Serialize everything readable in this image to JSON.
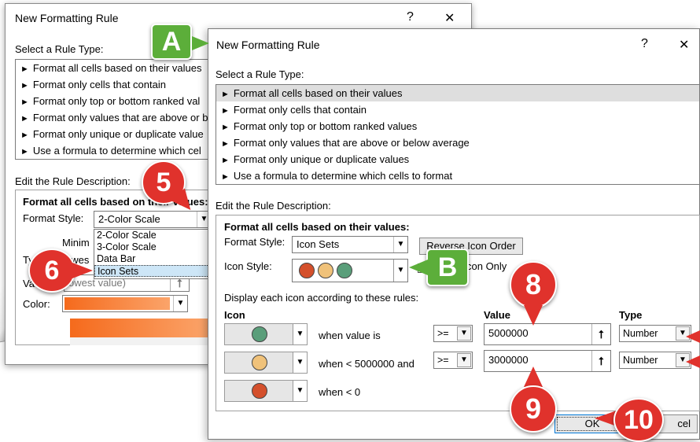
{
  "back_dialog": {
    "title": "New Formatting Rule",
    "help": "?",
    "close": "✕",
    "select_rule_type_label": "Select a Rule Type:",
    "rule_types": [
      "Format all cells based on their values",
      "Format only cells that contain",
      "Format only top or bottom ranked val",
      "Format only values that are above or b",
      "Format only unique or duplicate value",
      "Use a formula to determine which cel"
    ],
    "edit_label": "Edit the Rule Description:",
    "format_all_label": "Format all cells based on their values:",
    "format_style_label": "Format Style:",
    "format_style_value": "2-Color Scale",
    "minimum_label": "Minim",
    "type_label": "Typ",
    "type_partial": "owes",
    "value_label": "Va",
    "value_placeholder": "owest value)",
    "color_label": "Color:",
    "dropdown_options": [
      "2-Color Scale",
      "3-Color Scale",
      "Data Bar",
      "Icon Sets"
    ],
    "selected_option": "Icon Sets"
  },
  "front_dialog": {
    "title": "New Formatting Rule",
    "help": "?",
    "close": "✕",
    "select_rule_type_label": "Select a Rule Type:",
    "rule_types": [
      "Format all cells based on their values",
      "Format only cells that contain",
      "Format only top or bottom ranked values",
      "Format only values that are above or below average",
      "Format only unique or duplicate values",
      "Use a formula to determine which cells to format"
    ],
    "edit_label": "Edit the Rule Description:",
    "format_all_label": "Format all cells based on their values:",
    "format_style_label": "Format Style:",
    "format_style_value": "Icon Sets",
    "reverse_icon_order": "Reverse Icon Order",
    "icon_style_label": "Icon Style:",
    "show_icon_only": "con Only",
    "display_rules_label": "Display each icon according to these rules:",
    "col_icon": "Icon",
    "col_value": "Value",
    "col_type": "Type",
    "rules": [
      {
        "icon_color": "#5a9e7a",
        "condition": "when value is",
        "operator": ">=",
        "value": "5000000",
        "type": "Number"
      },
      {
        "icon_color": "#f0c27a",
        "condition": "when < 5000000 and",
        "operator": ">=",
        "value": "3000000",
        "type": "Number"
      },
      {
        "icon_color": "#d4502c",
        "condition": "when < 0"
      }
    ],
    "ok": "OK",
    "cancel_partial": "cel"
  },
  "callouts": {
    "A": "A",
    "B": "B",
    "five": "5",
    "six": "6",
    "eight": "8",
    "nine": "9",
    "ten": "10"
  },
  "colors": {
    "callout_green": "#5cae3a",
    "callout_red": "#e0322c",
    "icon_red": "#d4502c",
    "icon_yellow": "#f0c27a",
    "icon_green": "#5a9e7a",
    "color_bar": "#f56a1c"
  }
}
